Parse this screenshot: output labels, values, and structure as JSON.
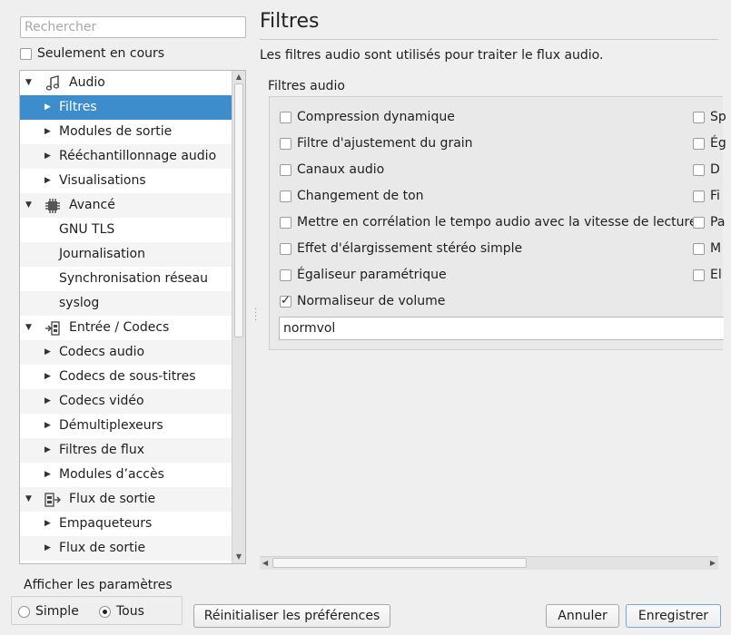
{
  "search": {
    "placeholder": "Rechercher"
  },
  "only_current": {
    "label": "Seulement en cours",
    "checked": false
  },
  "tree": {
    "items": [
      {
        "label": "Audio",
        "level": 0,
        "expanded": true,
        "icon": "audio-note-icon"
      },
      {
        "label": "Filtres",
        "level": 1,
        "selected": true
      },
      {
        "label": "Modules de sortie",
        "level": 1
      },
      {
        "label": "Rééchantillonnage audio",
        "level": 1
      },
      {
        "label": "Visualisations",
        "level": 1
      },
      {
        "label": "Avancé",
        "level": 0,
        "expanded": true,
        "icon": "chip-icon"
      },
      {
        "label": "GNU TLS",
        "level": 1,
        "leaf": true
      },
      {
        "label": "Journalisation",
        "level": 1,
        "leaf": true
      },
      {
        "label": "Synchronisation réseau",
        "level": 1,
        "leaf": true
      },
      {
        "label": "syslog",
        "level": 1,
        "leaf": true
      },
      {
        "label": "Entrée / Codecs",
        "level": 0,
        "expanded": true,
        "icon": "input-codecs-icon"
      },
      {
        "label": "Codecs audio",
        "level": 1
      },
      {
        "label": "Codecs de sous-titres",
        "level": 1
      },
      {
        "label": "Codecs vidéo",
        "level": 1
      },
      {
        "label": "Démultiplexeurs",
        "level": 1
      },
      {
        "label": "Filtres de flux",
        "level": 1
      },
      {
        "label": "Modules d’accès",
        "level": 1
      },
      {
        "label": "Flux de sortie",
        "level": 0,
        "expanded": true,
        "icon": "stream-output-icon"
      },
      {
        "label": "Empaqueteurs",
        "level": 1
      },
      {
        "label": "Flux de sortie",
        "level": 1
      }
    ]
  },
  "panel": {
    "title": "Filtres",
    "description": "Les filtres audio sont utilisés pour traiter le flux audio.",
    "group_label": "Filtres audio",
    "options_left": [
      {
        "label": "Compression dynamique",
        "checked": false
      },
      {
        "label": "Filtre d'ajustement du grain",
        "checked": false
      },
      {
        "label": "Canaux audio",
        "checked": false
      },
      {
        "label": "Changement de ton",
        "checked": false
      },
      {
        "label": "Mettre en corrélation le tempo audio avec la vitesse de lecture",
        "checked": false
      },
      {
        "label": "Effet d'élargissement stéréo simple",
        "checked": false
      },
      {
        "label": "Égaliseur paramétrique",
        "checked": false
      },
      {
        "label": "Normaliseur de volume",
        "checked": true
      }
    ],
    "options_right": [
      {
        "label": "Sp",
        "checked": false
      },
      {
        "label": "Ég",
        "checked": false
      },
      {
        "label": "D",
        "checked": false
      },
      {
        "label": "Fi",
        "checked": false
      },
      {
        "label": "Pa",
        "checked": false
      },
      {
        "label": "M",
        "checked": false
      },
      {
        "label": "El",
        "checked": false
      }
    ],
    "filter_value": "normvol"
  },
  "bottom": {
    "params_label": "Afficher les paramètres",
    "simple_label": "Simple",
    "all_label": "Tous",
    "selected_mode": "Tous",
    "reset_label": "Réinitialiser les préférences",
    "cancel_label": "Annuler",
    "save_label": "Enregistrer"
  }
}
